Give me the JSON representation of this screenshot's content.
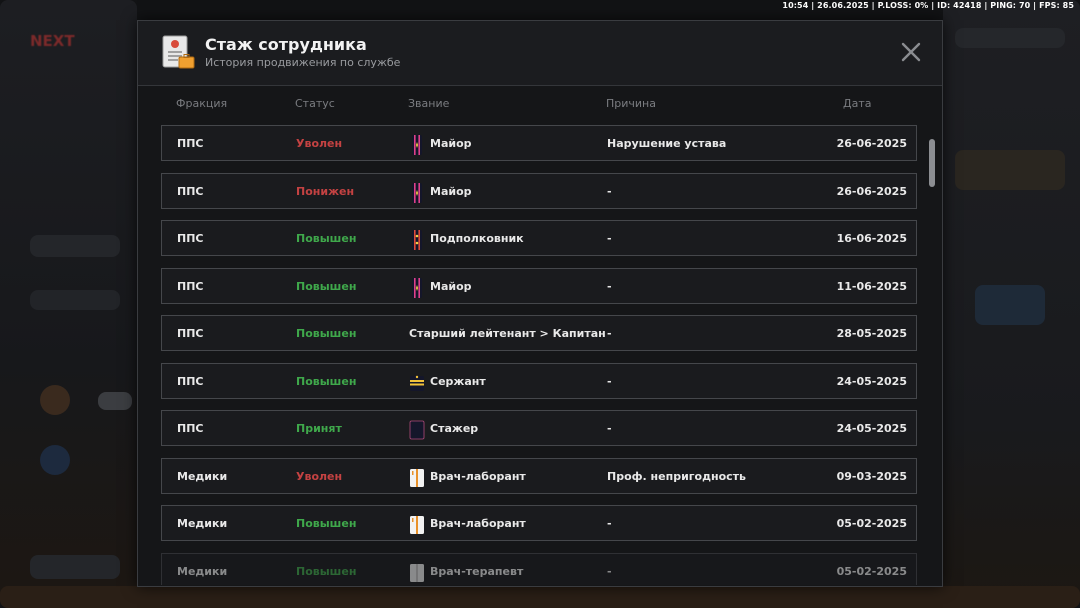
{
  "hud": {
    "text": "10:54 | 26.06.2025 | P.LOSS: 0% | ID: 42418 | PING: 70 | FPS: 85"
  },
  "modal": {
    "title": "Стаж сотрудника",
    "subtitle": "История продвижения по службе"
  },
  "columns": {
    "faction": "Фракция",
    "status": "Статус",
    "rank": "Звание",
    "reason": "Причина",
    "date": "Дата"
  },
  "status_colors": {
    "Уволен": "#c44242",
    "Понижен": "#c44242",
    "Повышен": "#3fa84b",
    "Принят": "#3fa84b"
  },
  "rows": [
    {
      "faction": "ППС",
      "status": "Уволен",
      "rank": "Майор",
      "rank_icon": "major-epaulette-icon",
      "reason": "Нарушение устава",
      "date": "26-06-2025"
    },
    {
      "faction": "ППС",
      "status": "Понижен",
      "rank": "Майор",
      "rank_icon": "major-epaulette-icon",
      "reason": "-",
      "date": "26-06-2025"
    },
    {
      "faction": "ППС",
      "status": "Повышен",
      "rank": "Подполковник",
      "rank_icon": "lt-colonel-epaulette-icon",
      "reason": "-",
      "date": "16-06-2025"
    },
    {
      "faction": "ППС",
      "status": "Повышен",
      "rank": "Майор",
      "rank_icon": "major-epaulette-icon",
      "reason": "-",
      "date": "11-06-2025"
    },
    {
      "faction": "ППС",
      "status": "Повышен",
      "rank": "Старший лейтенант > Капитан",
      "rank_icon": "",
      "reason": "-",
      "date": "28-05-2025"
    },
    {
      "faction": "ППС",
      "status": "Повышен",
      "rank": "Сержант",
      "rank_icon": "sergeant-epaulette-icon",
      "reason": "-",
      "date": "24-05-2025"
    },
    {
      "faction": "ППС",
      "status": "Принят",
      "rank": "Стажер",
      "rank_icon": "trainee-epaulette-icon",
      "reason": "-",
      "date": "24-05-2025"
    },
    {
      "faction": "Медики",
      "status": "Уволен",
      "rank": "Врач-лаборант",
      "rank_icon": "medic-coat-icon",
      "reason": "Проф. непригодность",
      "date": "09-03-2025"
    },
    {
      "faction": "Медики",
      "status": "Повышен",
      "rank": "Врач-лаборант",
      "rank_icon": "medic-coat-icon",
      "reason": "-",
      "date": "05-02-2025"
    },
    {
      "faction": "Медики",
      "status": "Повышен",
      "rank": "Врач-терапевт",
      "rank_icon": "doctor-coat-icon",
      "reason": "-",
      "date": "05-02-2025"
    }
  ]
}
